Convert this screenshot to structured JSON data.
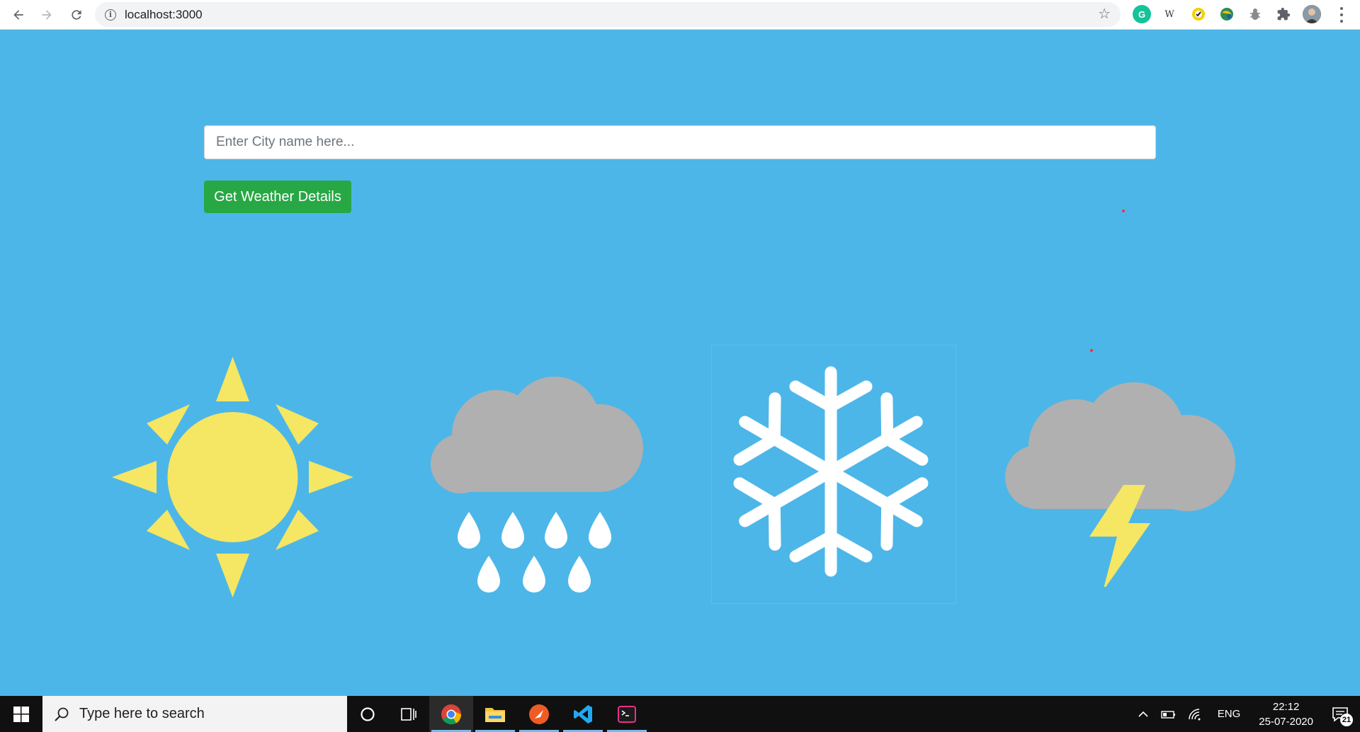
{
  "browser": {
    "url": "localhost:3000",
    "extensions": [
      "grammarly-icon",
      "wikipedia-icon",
      "norton-icon",
      "globe-extension-icon",
      "bug-icon",
      "puzzle-icon",
      "profile-avatar"
    ]
  },
  "weather_form": {
    "city_placeholder": "Enter City name here...",
    "city_value": "",
    "submit_label": "Get Weather Details"
  },
  "weather_icons": [
    "sun-icon",
    "rain-cloud-icon",
    "snowflake-icon",
    "thunderstorm-icon"
  ],
  "taskbar": {
    "search_placeholder": "Type here to search",
    "apps": [
      "chrome-icon",
      "file-explorer-icon",
      "postman-icon",
      "vscode-icon",
      "terminal-icon"
    ],
    "language": "ENG",
    "time": "22:12",
    "date": "25-07-2020",
    "notification_count": "21"
  },
  "colors": {
    "page_background": "#4db6e8",
    "button": "#28a745",
    "sun": "#f5e663",
    "cloud": "#b0b0b0",
    "lightning": "#f5e663"
  }
}
